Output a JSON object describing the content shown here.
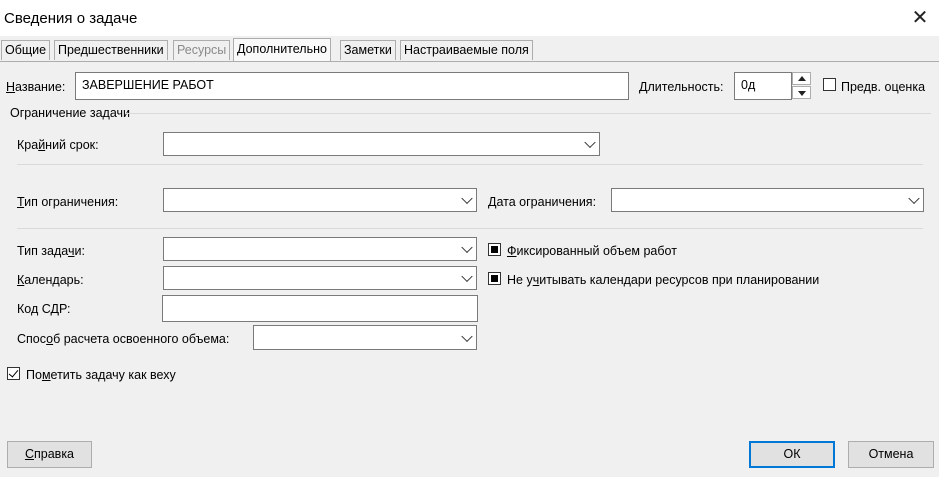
{
  "window": {
    "title": "Сведения о задаче",
    "close_icon": "close-icon"
  },
  "tabs": [
    {
      "label": "Общие",
      "state": "normal"
    },
    {
      "label": "Предшественники",
      "state": "normal"
    },
    {
      "label": "Ресурсы",
      "state": "disabled"
    },
    {
      "label": "Дополнительно",
      "state": "active"
    },
    {
      "label": "Заметки",
      "state": "normal"
    },
    {
      "label": "Настраиваемые поля",
      "state": "normal"
    }
  ],
  "name_field": {
    "label": "Название:",
    "value": "ЗАВЕРШЕНИЕ РАБОТ"
  },
  "duration": {
    "label": "Длительность:",
    "value": "0д"
  },
  "estimated": {
    "label": "Предв. оценка",
    "checked": false
  },
  "constraint_group": {
    "label": "Ограничение задачи"
  },
  "deadline": {
    "label": "Крайний срок:",
    "value": ""
  },
  "constraint_type": {
    "label": "Тип ограничения:",
    "value": ""
  },
  "constraint_date": {
    "label": "Дата ограничения:",
    "value": ""
  },
  "task_type": {
    "label": "Тип задачи:",
    "value": ""
  },
  "calendar": {
    "label": "Календарь:",
    "value": ""
  },
  "wbs": {
    "label": "Код СДР:",
    "value": ""
  },
  "earned_value": {
    "label": "Способ расчета освоенного объема:",
    "value": ""
  },
  "effort_driven": {
    "label": "Фиксированный объем работ",
    "state": "indeterminate"
  },
  "ignore_calendars": {
    "label": "Не учитывать календари ресурсов при планировании",
    "state": "indeterminate"
  },
  "milestone": {
    "label": "Пометить задачу как веху",
    "checked": true
  },
  "buttons": {
    "help": "Справка",
    "ok": "ОК",
    "cancel": "Отмена"
  }
}
